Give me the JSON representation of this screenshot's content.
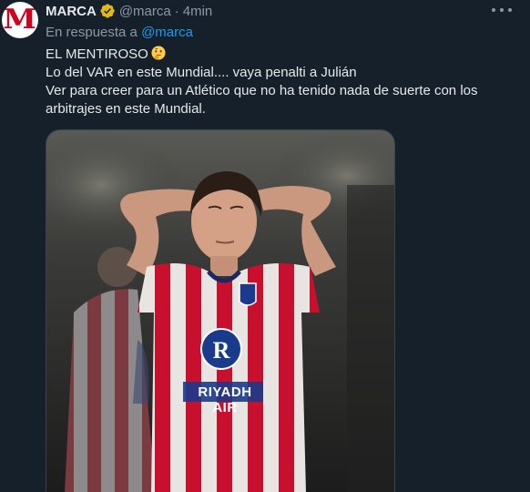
{
  "tweet": {
    "author": {
      "display_name": "MARCA",
      "handle": "@marca",
      "avatar_letter": "M",
      "avatar_color": "#d1001f",
      "verified_color": "#e2b719"
    },
    "separator": "·",
    "timestamp": "4min",
    "reply_prefix": "En respuesta a",
    "reply_to": "@marca",
    "lines": [
      "EL MENTIROSO",
      "Lo del VAR en este Mundial.... vaya penalti a Julián",
      "Ver para creer para un Atlético que no ha tenido nada de suerte con los arbitrajes en este Mundial."
    ],
    "emoji": "thinking-face-emoji",
    "media": {
      "sponsor": "RIYADH AIR"
    }
  },
  "colors": {
    "background": "#15202b",
    "accent": "#1d9bf0",
    "muted": "#8b98a5"
  }
}
